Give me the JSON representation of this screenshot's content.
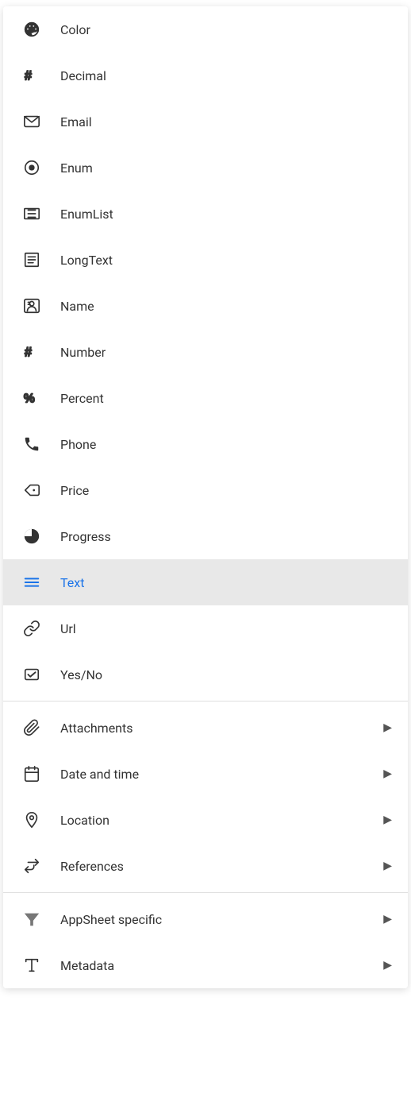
{
  "menu": {
    "items_basic": [
      {
        "id": "color",
        "label": "Color",
        "icon": "color"
      },
      {
        "id": "decimal",
        "label": "Decimal",
        "icon": "decimal"
      },
      {
        "id": "email",
        "label": "Email",
        "icon": "email"
      },
      {
        "id": "enum",
        "label": "Enum",
        "icon": "enum"
      },
      {
        "id": "enumlist",
        "label": "EnumList",
        "icon": "enumlist"
      },
      {
        "id": "longtext",
        "label": "LongText",
        "icon": "longtext"
      },
      {
        "id": "name",
        "label": "Name",
        "icon": "name"
      },
      {
        "id": "number",
        "label": "Number",
        "icon": "number"
      },
      {
        "id": "percent",
        "label": "Percent",
        "icon": "percent"
      },
      {
        "id": "phone",
        "label": "Phone",
        "icon": "phone"
      },
      {
        "id": "price",
        "label": "Price",
        "icon": "price"
      },
      {
        "id": "progress",
        "label": "Progress",
        "icon": "progress"
      },
      {
        "id": "text",
        "label": "Text",
        "icon": "text",
        "selected": true
      },
      {
        "id": "url",
        "label": "Url",
        "icon": "url"
      },
      {
        "id": "yesno",
        "label": "Yes/No",
        "icon": "yesno"
      }
    ],
    "items_sub": [
      {
        "id": "attachments",
        "label": "Attachments",
        "icon": "attachments",
        "arrow": true
      },
      {
        "id": "datetime",
        "label": "Date and time",
        "icon": "datetime",
        "arrow": true
      },
      {
        "id": "location",
        "label": "Location",
        "icon": "location",
        "arrow": true
      },
      {
        "id": "references",
        "label": "References",
        "icon": "references",
        "arrow": true
      }
    ],
    "items_specific": [
      {
        "id": "appsheet",
        "label": "AppSheet specific",
        "icon": "appsheet",
        "arrow": true
      },
      {
        "id": "metadata",
        "label": "Metadata",
        "icon": "metadata",
        "arrow": true
      }
    ]
  }
}
